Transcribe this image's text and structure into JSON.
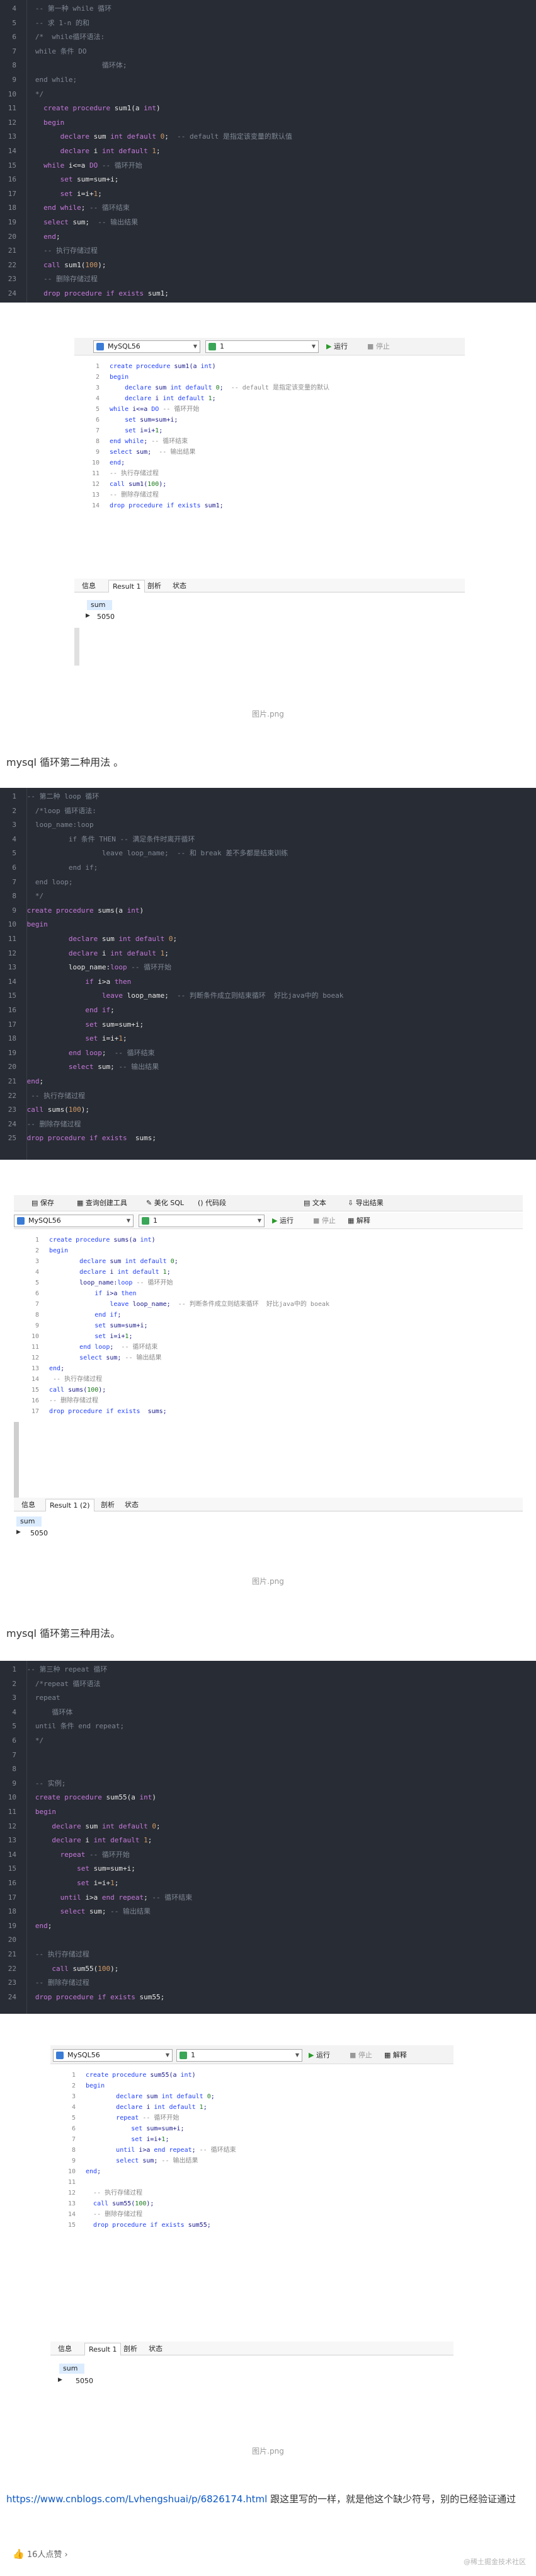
{
  "block1": {
    "lines": [
      [
        "4",
        "  -- 第一种 while 循环"
      ],
      [
        "5",
        "  -- 求 1-n 的和"
      ],
      [
        "6",
        "  /*  while循环语法:"
      ],
      [
        "7",
        "  while 条件 DO"
      ],
      [
        "8",
        "                  循环体;"
      ],
      [
        "9",
        "  end while;"
      ],
      [
        "10",
        "  */"
      ],
      [
        "11",
        "    create procedure sum1(a int)"
      ],
      [
        "12",
        "    begin"
      ],
      [
        "13",
        "        declare sum int default 0;  -- default 是指定该变量的默认值"
      ],
      [
        "14",
        "        declare i int default 1;"
      ],
      [
        "15",
        "    while i<=a DO -- 循环开始"
      ],
      [
        "16",
        "        set sum=sum+i;"
      ],
      [
        "17",
        "        set i=i+1;"
      ],
      [
        "18",
        "    end while; -- 循环结束"
      ],
      [
        "19",
        "    select sum;  -- 输出结果"
      ],
      [
        "20",
        "    end;"
      ],
      [
        "21",
        "    -- 执行存储过程"
      ],
      [
        "22",
        "    call sum1(100);"
      ],
      [
        "23",
        "    -- 删除存储过程"
      ],
      [
        "24",
        "    drop procedure if exists sum1;"
      ]
    ]
  },
  "shot1": {
    "db": "MySQL56",
    "schema": "1",
    "run": "运行",
    "stop": "停止",
    "lines": [
      [
        "1",
        "create procedure sum1(a int)"
      ],
      [
        "2",
        "begin"
      ],
      [
        "3",
        "    declare sum int default 0;  -- default 是指定该变量的默认"
      ],
      [
        "4",
        "    declare i int default 1;"
      ],
      [
        "5",
        "while i<=a DO -- 循环开始"
      ],
      [
        "6",
        "    set sum=sum+i;"
      ],
      [
        "7",
        "    set i=i+1;"
      ],
      [
        "8",
        "end while; -- 循环结束"
      ],
      [
        "9",
        "select sum;  -- 输出结果"
      ],
      [
        "10",
        "end;"
      ],
      [
        "11",
        "-- 执行存储过程"
      ],
      [
        "12",
        "call sum1(100);"
      ],
      [
        "13",
        "-- 删除存储过程"
      ],
      [
        "14",
        "drop procedure if exists sum1;"
      ]
    ],
    "tabs": [
      "信息",
      "Result 1",
      "剖析",
      "状态"
    ],
    "col": "sum",
    "value": "5050",
    "caption": "图片.png"
  },
  "para1": "mysql 循环第二种用法 。",
  "block2": {
    "lines": [
      [
        "1",
        "-- 第二种 loop 循环"
      ],
      [
        "2",
        "  /*loop 循环语法:"
      ],
      [
        "3",
        "  loop_name:loop"
      ],
      [
        "4",
        "          if 条件 THEN -- 满足条件时离开循环"
      ],
      [
        "5",
        "                  leave loop_name;  -- 和 break 差不多都是结束训练"
      ],
      [
        "6",
        "          end if;"
      ],
      [
        "7",
        "  end loop;"
      ],
      [
        "8",
        "  */"
      ],
      [
        "9",
        "create procedure sums(a int)"
      ],
      [
        "10",
        "begin"
      ],
      [
        "11",
        "          declare sum int default 0;"
      ],
      [
        "12",
        "          declare i int default 1;"
      ],
      [
        "13",
        "          loop_name:loop -- 循环开始"
      ],
      [
        "14",
        "              if i>a then"
      ],
      [
        "15",
        "                  leave loop_name;  -- 判断条件成立则结束循环  好比java中的 boeak"
      ],
      [
        "16",
        "              end if;"
      ],
      [
        "17",
        "              set sum=sum+i;"
      ],
      [
        "18",
        "              set i=i+1;"
      ],
      [
        "19",
        "          end loop;  -- 循环结束"
      ],
      [
        "20",
        "          select sum; -- 输出结果"
      ],
      [
        "21",
        "end;"
      ],
      [
        "22",
        " -- 执行存储过程"
      ],
      [
        "23",
        "call sums(100);"
      ],
      [
        "24",
        "-- 删除存储过程"
      ],
      [
        "25",
        "drop procedure if exists  sums;"
      ]
    ]
  },
  "shot2": {
    "save": "保存",
    "query_builder": "查询创建工具",
    "beautify": "美化 SQL",
    "snippet": "代码段",
    "text": "文本",
    "export": "导出结果",
    "db": "MySQL56",
    "schema": "1",
    "run": "运行",
    "stop": "停止",
    "explain": "解释",
    "lines": [
      [
        "1",
        "create procedure sums(a int)"
      ],
      [
        "2",
        "begin"
      ],
      [
        "3",
        "        declare sum int default 0;"
      ],
      [
        "4",
        "        declare i int default 1;"
      ],
      [
        "5",
        "        loop_name:loop -- 循环开始"
      ],
      [
        "6",
        "            if i>a then"
      ],
      [
        "7",
        "                leave loop_name;  -- 判断条件成立则结束循环  好比java中的 boeak"
      ],
      [
        "8",
        "            end if;"
      ],
      [
        "9",
        "            set sum=sum+i;"
      ],
      [
        "10",
        "            set i=i+1;"
      ],
      [
        "11",
        "        end loop;  -- 循环结束"
      ],
      [
        "12",
        "        select sum; -- 输出结果"
      ],
      [
        "13",
        "end;"
      ],
      [
        "14",
        " -- 执行存储过程"
      ],
      [
        "15",
        "call sums(100);"
      ],
      [
        "16",
        "-- 删除存储过程"
      ],
      [
        "17",
        "drop procedure if exists  sums;"
      ]
    ],
    "tabs": [
      "信息",
      "Result 1 (2)",
      "剖析",
      "状态"
    ],
    "col": "sum",
    "value": "5050",
    "caption": "图片.png"
  },
  "para2": "mysql 循环第三种用法。",
  "block3": {
    "lines": [
      [
        "1",
        "-- 第三种 repeat 循环"
      ],
      [
        "2",
        "  /*repeat 循环语法"
      ],
      [
        "3",
        "  repeat"
      ],
      [
        "4",
        "      循环体"
      ],
      [
        "5",
        "  until 条件 end repeat;"
      ],
      [
        "6",
        "  */"
      ],
      [
        "7",
        ""
      ],
      [
        "8",
        ""
      ],
      [
        "9",
        "  -- 实例;"
      ],
      [
        "10",
        "  create procedure sum55(a int)"
      ],
      [
        "11",
        "  begin"
      ],
      [
        "12",
        "      declare sum int default 0;"
      ],
      [
        "13",
        "      declare i int default 1;"
      ],
      [
        "14",
        "        repeat -- 循环开始"
      ],
      [
        "15",
        "            set sum=sum+i;"
      ],
      [
        "16",
        "            set i=i+1;"
      ],
      [
        "17",
        "        until i>a end repeat; -- 循环结束"
      ],
      [
        "18",
        "        select sum; -- 输出结果"
      ],
      [
        "19",
        "  end;"
      ],
      [
        "20",
        ""
      ],
      [
        "21",
        "  -- 执行存储过程"
      ],
      [
        "22",
        "      call sum55(100);"
      ],
      [
        "23",
        "  -- 删除存储过程"
      ],
      [
        "24",
        "  drop procedure if exists sum55;"
      ]
    ]
  },
  "shot3": {
    "db": "MySQL56",
    "schema": "1",
    "run": "运行",
    "stop": "停止",
    "explain": "解释",
    "lines": [
      [
        "1",
        "create procedure sum55(a int)"
      ],
      [
        "2",
        "begin"
      ],
      [
        "3",
        "        declare sum int default 0;"
      ],
      [
        "4",
        "        declare i int default 1;"
      ],
      [
        "5",
        "        repeat -- 循环开始"
      ],
      [
        "6",
        "            set sum=sum+i;"
      ],
      [
        "7",
        "            set i=i+1;"
      ],
      [
        "8",
        "        until i>a end repeat; -- 循环结束"
      ],
      [
        "9",
        "        select sum; -- 输出结果"
      ],
      [
        "10",
        "end;"
      ],
      [
        "11",
        ""
      ],
      [
        "12",
        "  -- 执行存储过程"
      ],
      [
        "13",
        "  call sum55(100);"
      ],
      [
        "14",
        "  -- 删除存储过程"
      ],
      [
        "15",
        "  drop procedure if exists sum55;"
      ]
    ],
    "tabs": [
      "信息",
      "Result 1",
      "剖析",
      "状态"
    ],
    "col": "sum",
    "value": "5050",
    "caption": "图片.png"
  },
  "footer": {
    "link": "https://www.cnblogs.com/Lvhengshuai/p/6826174.html",
    "text_after": " 跟这里写的一样，就是他这个缺少符号，别的已经验证通过",
    "like": "16人点赞",
    "watermark": "@稀土掘金技术社区"
  }
}
